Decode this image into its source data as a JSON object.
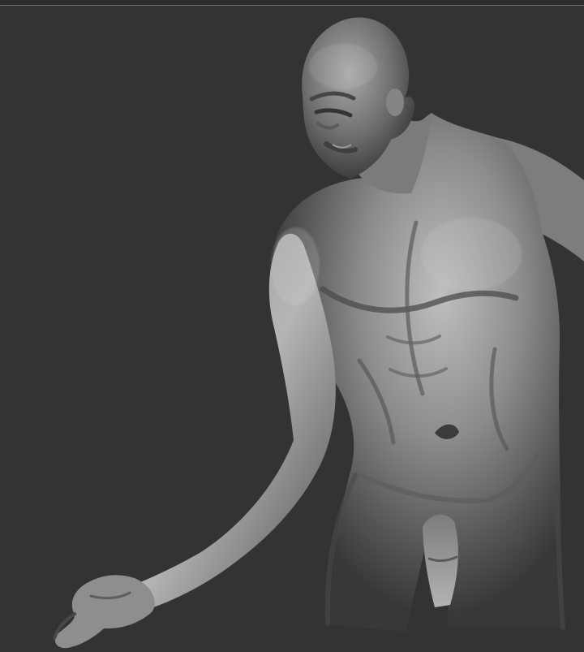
{
  "viewport": {
    "background_color": "#333333",
    "separator_color": "#6f6f6f",
    "material_color": "#8f8f8f"
  },
  "model": {
    "subject": "sculpted-male-torso",
    "icon": "sculpt-model-icon"
  }
}
